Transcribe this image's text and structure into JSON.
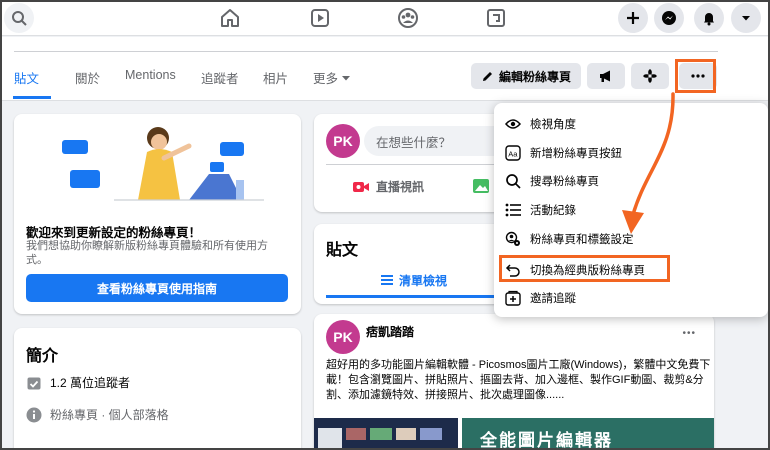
{
  "page_tabs": [
    {
      "label": "貼文",
      "active": true
    },
    {
      "label": "關於"
    },
    {
      "label": "Mentions"
    },
    {
      "label": "追蹤者"
    },
    {
      "label": "相片"
    },
    {
      "label": "更多"
    }
  ],
  "header_buttons": {
    "edit_label": "編輯粉絲專頁"
  },
  "welcome": {
    "title": "歡迎來到更新設定的粉絲專頁！",
    "description": "我們想協助你瞭解新版粉絲專頁體驗和所有使用方式。",
    "button_label": "查看粉絲專頁使用指南"
  },
  "intro": {
    "title": "簡介",
    "followers": "1.2 萬位追蹤者",
    "category": "粉絲專頁 · 個人部落格"
  },
  "composer": {
    "avatar_text": "PK",
    "placeholder": "在想些什麼？",
    "live_label": "直播視訊"
  },
  "posts_section": {
    "title": "貼文",
    "list_view_label": "清單檢視"
  },
  "post": {
    "avatar_text": "PK",
    "author": "痞凱踏踏",
    "more": "•••",
    "text": "超好用的多功能圖片編輯軟體 - Picosmos圖片工廠(Windows)，繁體中文免費下載！包含瀏覽圖片、拼貼照片、摳圖去背、加入邊框、製作GIF動圖、裁剪&分割、添加濾鏡特效、拼接照片、批次處理圖像......",
    "image_caption": "全能圖片編輯器"
  },
  "menu": {
    "items": [
      {
        "label": "檢視角度",
        "icon": "eye-icon"
      },
      {
        "label": "新增粉絲專頁按鈕",
        "icon": "button-icon"
      },
      {
        "label": "搜尋粉絲專頁",
        "icon": "search-icon"
      },
      {
        "label": "活動紀錄",
        "icon": "list-icon"
      },
      {
        "label": "粉絲專頁和標籤設定",
        "icon": "settings-icon"
      },
      {
        "label": "切換為經典版粉絲專頁",
        "icon": "undo-icon",
        "highlighted": true
      },
      {
        "label": "邀請追蹤",
        "icon": "invite-icon"
      }
    ]
  },
  "colors": {
    "accent": "#1877f2",
    "highlight": "#f26522"
  }
}
